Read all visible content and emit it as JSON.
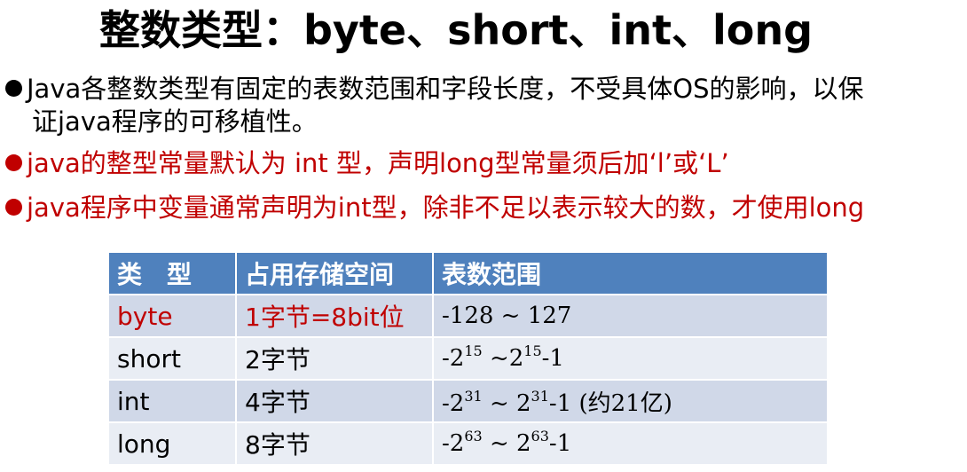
{
  "title": "整数类型：byte、short、int、long",
  "bullets": [
    {
      "line1": "Java各整数类型有固定的表数范围和字段长度，不受具体OS的影响，以保",
      "line2": "证java程序的可移植性。",
      "color": "#000000"
    },
    {
      "text": "java的整型常量默认为 int 型，声明long型常量须后加‘l’或‘L’",
      "color": "#c00000"
    },
    {
      "text": "java程序中变量通常声明为int型，除非不足以表示较大的数，才使用long",
      "color": "#c00000"
    }
  ],
  "table": {
    "headers": [
      "类　型",
      "占用存储空间",
      "表数范围"
    ],
    "rows": [
      {
        "type": "byte",
        "size": "1字节=8bit位",
        "range": "-128 ~ 127"
      },
      {
        "type": "short",
        "size": "2字节",
        "range": {
          "pre": "-2",
          "exp1": "15",
          "mid": " ~2",
          "exp2": "15",
          "post": "-1"
        }
      },
      {
        "type": "int",
        "size": "4字节",
        "range": {
          "pre": "-2",
          "exp1": "31",
          "mid": " ~ 2",
          "exp2": "31",
          "post": "-1 (约21亿)"
        }
      },
      {
        "type": "long",
        "size": "8字节",
        "range": {
          "pre": "-2",
          "exp1": "63",
          "mid": " ~ 2",
          "exp2": "63",
          "post": "-1"
        }
      }
    ]
  },
  "colors": {
    "header_bg": "#4f81bd",
    "row_odd_bg": "#d0d8e8",
    "row_even_bg": "#e9edf4",
    "accent_red": "#c00000"
  }
}
